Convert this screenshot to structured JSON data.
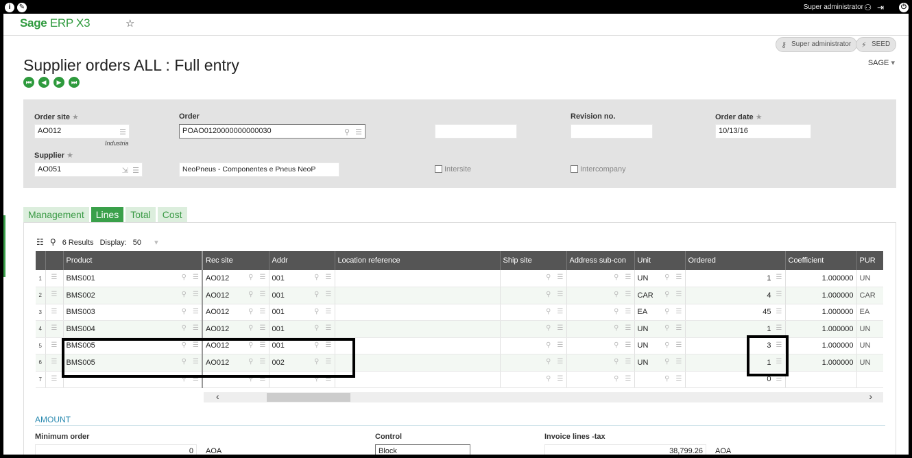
{
  "topbar": {
    "user_label": "Super administrator"
  },
  "header": {
    "logo_brand": "Sage",
    "logo_product": "ERP X3"
  },
  "actions": {
    "user_button": "Super administrator",
    "folder_button": "SEED",
    "folder_dropdown": "SAGE"
  },
  "page": {
    "title": "Supplier orders ALL : Full entry"
  },
  "form": {
    "order_site_label": "Order site",
    "order_site_value": "AO012",
    "order_site_sub": "Industria",
    "order_label": "Order",
    "order_value": "POAO0120000000000030",
    "revision_label": "Revision no.",
    "revision_value": "",
    "order_date_label": "Order date",
    "order_date_value": "10/13/16",
    "supplier_label": "Supplier",
    "supplier_value": "AO051",
    "supplier_name": "NeoPneus - Componentes e Pneus NeoP",
    "intersite_label": "Intersite",
    "intercompany_label": "Intercompany",
    "required_mark": "★"
  },
  "tabs": [
    "Management",
    "Lines",
    "Total",
    "Cost"
  ],
  "grid_toolbar": {
    "results": "6 Results",
    "display_label": "Display:",
    "display_value": "50"
  },
  "grid": {
    "columns": [
      "Product",
      "Rec site",
      "Addr",
      "Location reference",
      "Ship site",
      "Address sub-con",
      "Unit",
      "Ordered",
      "Coefficient",
      "PUR"
    ],
    "rows": [
      {
        "no": "1",
        "product": "BMS001",
        "rec_site": "AO012",
        "addr": "001",
        "unit": "UN",
        "ordered": "1",
        "coef": "1.000000",
        "pur": "UN"
      },
      {
        "no": "2",
        "product": "BMS002",
        "rec_site": "AO012",
        "addr": "001",
        "unit": "CAR",
        "ordered": "4",
        "coef": "1.000000",
        "pur": "CAR"
      },
      {
        "no": "3",
        "product": "BMS003",
        "rec_site": "AO012",
        "addr": "001",
        "unit": "EA",
        "ordered": "45",
        "coef": "1.000000",
        "pur": "EA"
      },
      {
        "no": "4",
        "product": "BMS004",
        "rec_site": "AO012",
        "addr": "001",
        "unit": "UN",
        "ordered": "1",
        "coef": "1.000000",
        "pur": "UN"
      },
      {
        "no": "5",
        "product": "BMS005",
        "rec_site": "AO012",
        "addr": "001",
        "unit": "UN",
        "ordered": "3",
        "coef": "1.000000",
        "pur": "UN"
      },
      {
        "no": "6",
        "product": "BMS005",
        "rec_site": "AO012",
        "addr": "002",
        "unit": "UN",
        "ordered": "1",
        "coef": "1.000000",
        "pur": "UN"
      },
      {
        "no": "7",
        "product": "",
        "rec_site": "",
        "addr": "",
        "unit": "",
        "ordered": "0",
        "coef": "",
        "pur": ""
      }
    ]
  },
  "amount": {
    "section_title": "AMOUNT",
    "min_order_label": "Minimum order",
    "min_order_value": "0",
    "min_order_currency": "AOA",
    "control_label": "Control",
    "control_value": "Block",
    "invoice_label": "Invoice lines -tax",
    "invoice_value": "38,799.26",
    "invoice_currency": "AOA"
  }
}
